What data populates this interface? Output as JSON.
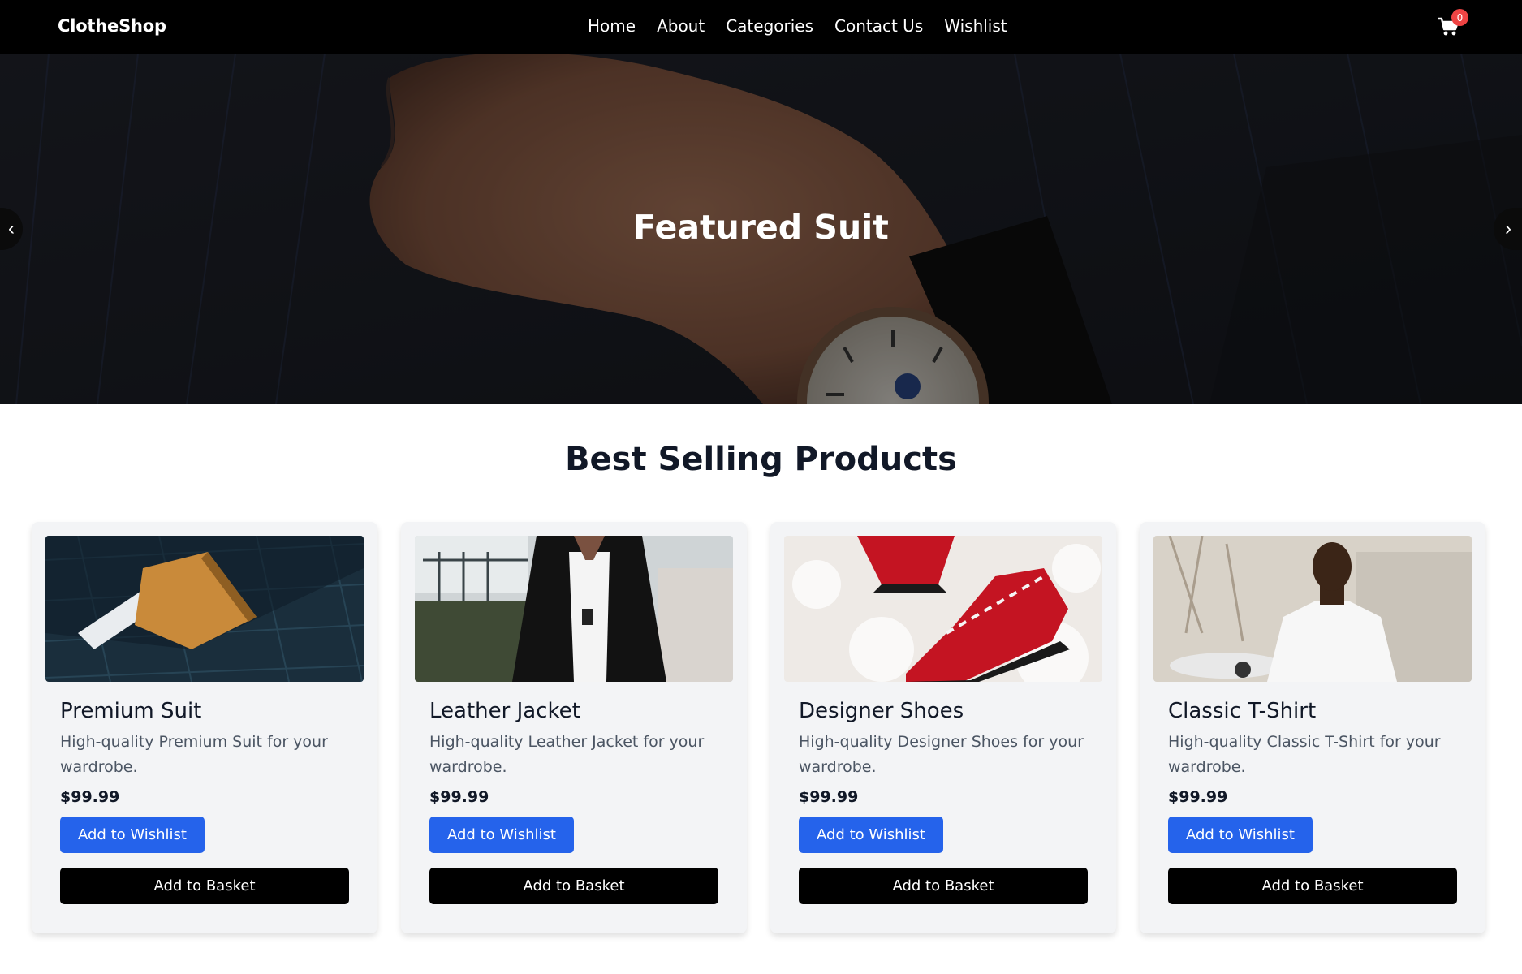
{
  "brand": "ClotheShop",
  "nav": {
    "items": [
      {
        "label": "Home"
      },
      {
        "label": "About"
      },
      {
        "label": "Categories"
      },
      {
        "label": "Contact Us"
      },
      {
        "label": "Wishlist"
      }
    ],
    "cart_count": "0",
    "cart_icon": "shopping-cart-icon"
  },
  "hero": {
    "title": "Featured Suit",
    "prev_icon": "‹",
    "next_icon": "›"
  },
  "section": {
    "title": "Best Selling Products"
  },
  "products": [
    {
      "name": "Premium Suit",
      "description": "High-quality Premium Suit for your wardrobe.",
      "price": "$99.99",
      "wishlist_label": "Add to Wishlist",
      "basket_label": "Add to Basket"
    },
    {
      "name": "Leather Jacket",
      "description": "High-quality Leather Jacket for your wardrobe.",
      "price": "$99.99",
      "wishlist_label": "Add to Wishlist",
      "basket_label": "Add to Basket"
    },
    {
      "name": "Designer Shoes",
      "description": "High-quality Designer Shoes for your wardrobe.",
      "price": "$99.99",
      "wishlist_label": "Add to Wishlist",
      "basket_label": "Add to Basket"
    },
    {
      "name": "Classic T-Shirt",
      "description": "High-quality Classic T-Shirt for your wardrobe.",
      "price": "$99.99",
      "wishlist_label": "Add to Wishlist",
      "basket_label": "Add to Basket"
    }
  ],
  "colors": {
    "navbar": "#000000",
    "accent": "#2563eb",
    "badge": "#ef4444",
    "card_bg": "#f3f4f6"
  }
}
